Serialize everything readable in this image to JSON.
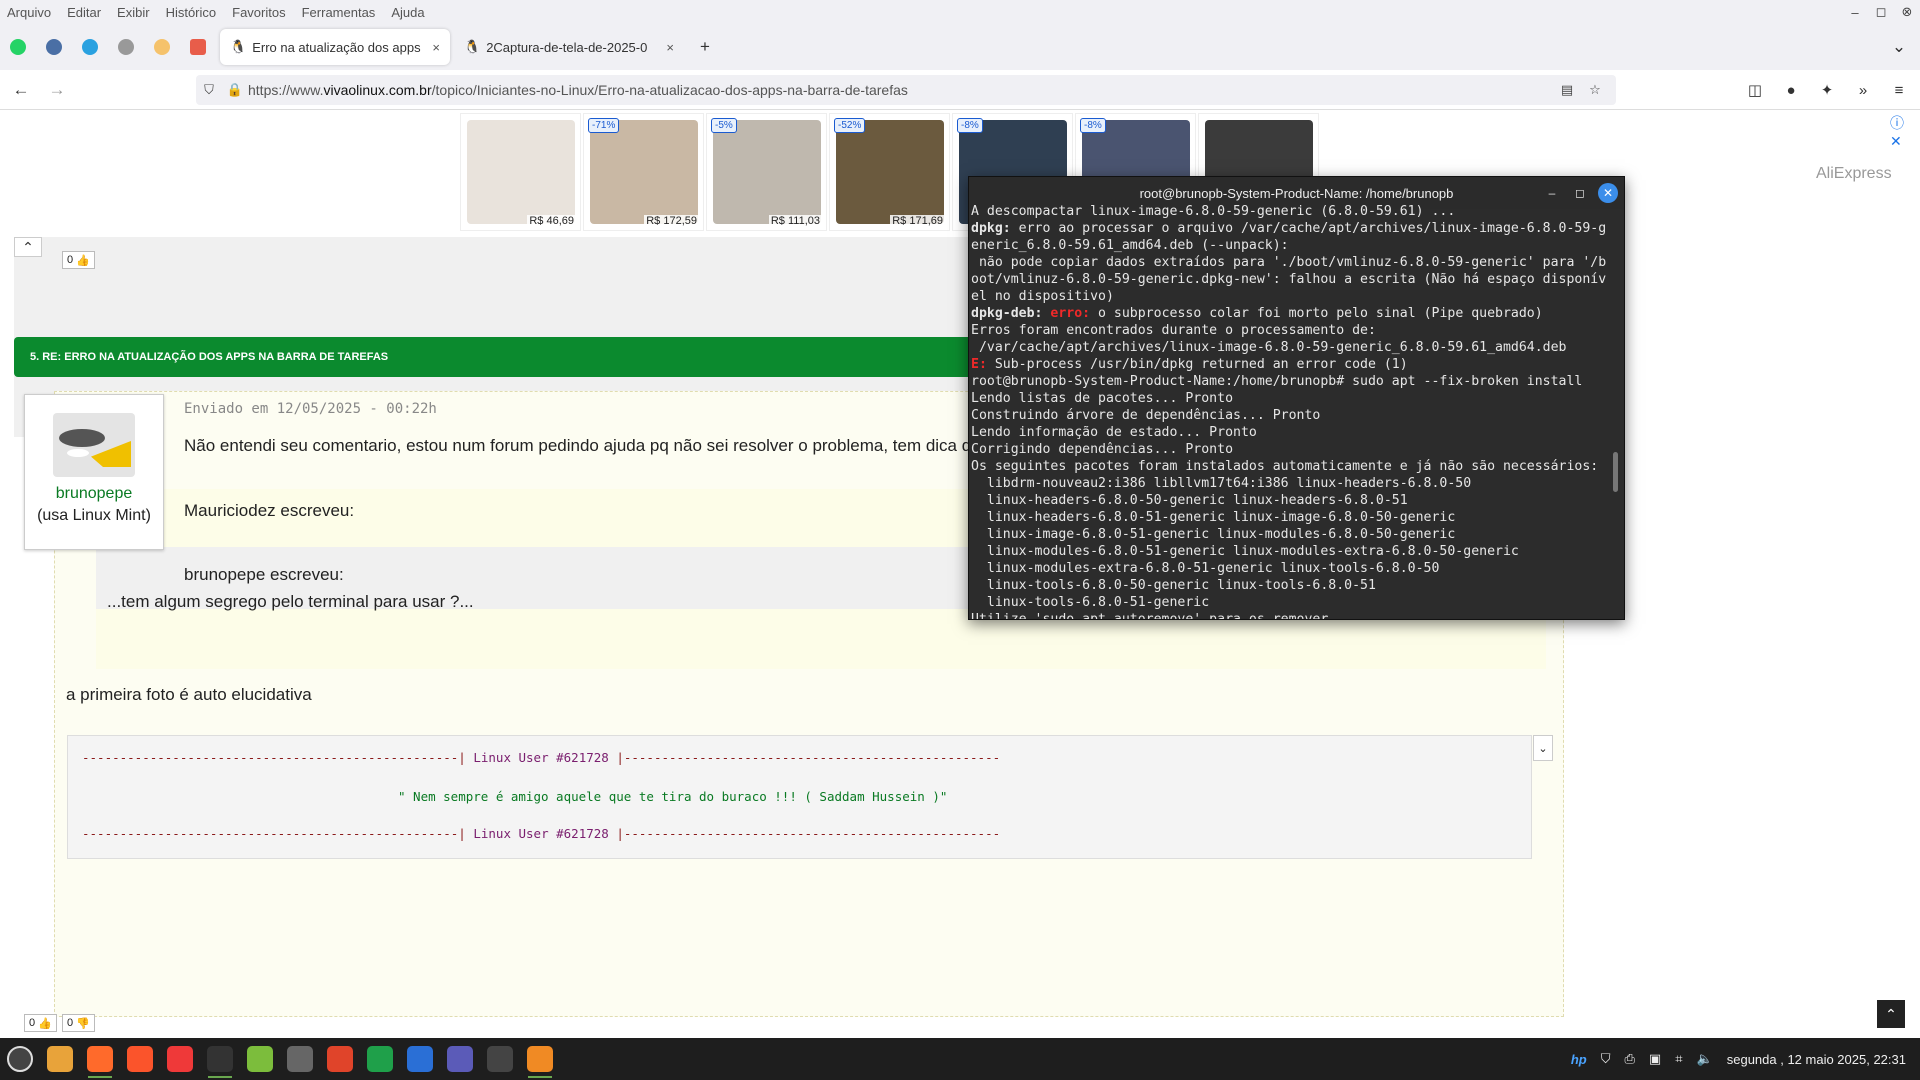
{
  "menu": [
    "Arquivo",
    "Editar",
    "Exibir",
    "Histórico",
    "Favoritos",
    "Ferramentas",
    "Ajuda"
  ],
  "tabs": [
    {
      "title": "Erro na atualização dos apps",
      "close": "×"
    },
    {
      "title": "2Captura-de-tela-de-2025-0",
      "close": "×"
    }
  ],
  "new_tab": "+",
  "url": {
    "prefix": "https://www.",
    "host": "vivaolinux.com.br",
    "path": "/topico/Iniciantes-no-Linux/Erro-na-atualizacao-dos-apps-na-barra-de-tarefas"
  },
  "ads": [
    {
      "discount": "",
      "price": "R$ 46,69",
      "color": "#e9e3dc"
    },
    {
      "discount": "-71%",
      "price": "R$ 172,59",
      "color": "#c9b8a4"
    },
    {
      "discount": "-5%",
      "price": "R$ 111,03",
      "color": "#bfb8ae"
    },
    {
      "discount": "-52%",
      "price": "R$ 171,69",
      "color": "#6b5a3e"
    },
    {
      "discount": "-8%",
      "price": "",
      "color": "#2f3f52"
    },
    {
      "discount": "-8%",
      "price": "",
      "color": "#4a5470"
    },
    {
      "discount": "",
      "price": "",
      "color": "#3b3b3b"
    }
  ],
  "ad_brand": "AliExpress",
  "votes": {
    "top": "0",
    "bottom_a": "0",
    "bottom_b": "0"
  },
  "post_header": "5. RE: ERRO NA ATUALIZAÇÃO DOS APPS NA BARRA DE TAREFAS",
  "user": {
    "name": "brunopepe",
    "distro": "(usa Linux Mint)"
  },
  "post": {
    "meta": "Enviado em 12/05/2025 - 00:22h",
    "text": "Não entendi seu comentario, estou num forum pedindo ajuda pq não sei resolver o problema, tem dica de",
    "quote_author": "Mauriciodez escreveu:",
    "nested_author": "brunopepe escreveu:",
    "nested_text": "...tem algum segrego pelo terminal para usar ?...",
    "reply": "a primeira foto é auto elucidativa"
  },
  "signature": {
    "dashes": "--------------------------------------------------|",
    "user": " Linux User #621728 ",
    "dashes2": "|--------------------------------------------------",
    "quote": "\" Nem sempre é amigo aquele que te tira do buraco !!! ( Saddam Hussein )\""
  },
  "terminal": {
    "title": "root@brunopb-System-Product-Name: /home/brunopb",
    "lines": [
      {
        "t": "A descompactar linux-image-6.8.0-59-generic (6.8.0-59.61) ..."
      },
      {
        "p": "dpkg:",
        "t": " erro ao processar o arquivo /var/cache/apt/archives/linux-image-6.8.0-59-g"
      },
      {
        "t": "eneric_6.8.0-59.61_amd64.deb (--unpack):"
      },
      {
        "t": " não pode copiar dados extraídos para './boot/vmlinuz-6.8.0-59-generic' para '/b"
      },
      {
        "t": "oot/vmlinuz-6.8.0-59-generic.dpkg-new': falhou a escrita (Não há espaço disponív"
      },
      {
        "t": "el no dispositivo)"
      },
      {
        "p": "dpkg-deb:",
        "e": " erro:",
        "t": " o subprocesso colar foi morto pelo sinal (Pipe quebrado)"
      },
      {
        "t": "Erros foram encontrados durante o processamento de:"
      },
      {
        "t": " /var/cache/apt/archives/linux-image-6.8.0-59-generic_6.8.0-59.61_amd64.deb"
      },
      {
        "e": "E:",
        "t": " Sub-process /usr/bin/dpkg returned an error code (1)"
      },
      {
        "t": "root@brunopb-System-Product-Name:/home/brunopb# sudo apt --fix-broken install"
      },
      {
        "t": "Lendo listas de pacotes... Pronto"
      },
      {
        "t": "Construindo árvore de dependências... Pronto"
      },
      {
        "t": "Lendo informação de estado... Pronto"
      },
      {
        "t": "Corrigindo dependências... Pronto"
      },
      {
        "t": "Os seguintes pacotes foram instalados automaticamente e já não são necessários:"
      },
      {
        "t": "  libdrm-nouveau2:i386 libllvm17t64:i386 linux-headers-6.8.0-50"
      },
      {
        "t": "  linux-headers-6.8.0-50-generic linux-headers-6.8.0-51"
      },
      {
        "t": "  linux-headers-6.8.0-51-generic linux-image-6.8.0-50-generic"
      },
      {
        "t": "  linux-image-6.8.0-51-generic linux-modules-6.8.0-50-generic"
      },
      {
        "t": "  linux-modules-6.8.0-51-generic linux-modules-extra-6.8.0-50-generic"
      },
      {
        "t": "  linux-modules-extra-6.8.0-51-generic linux-tools-6.8.0-50"
      },
      {
        "t": "  linux-tools-6.8.0-50-generic linux-tools-6.8.0-51"
      },
      {
        "t": "  linux-tools-6.8.0-51-generic"
      },
      {
        "t": "Utilize 'sudo apt autoremove' para os remover."
      }
    ]
  },
  "taskbar": {
    "apps": [
      {
        "name": "files-icon",
        "color": "#e8a33a",
        "open": false
      },
      {
        "name": "firefox-icon",
        "color": "#ff6a2b",
        "open": true
      },
      {
        "name": "brave-icon",
        "color": "#fb542b",
        "open": false
      },
      {
        "name": "vivaldi-icon",
        "color": "#ef3939",
        "open": false
      },
      {
        "name": "terminal-icon",
        "color": "#333333",
        "open": true
      },
      {
        "name": "chrome-icon",
        "color": "#7cbd3c",
        "open": false
      },
      {
        "name": "inkscape-icon",
        "color": "#666666",
        "open": false
      },
      {
        "name": "app-red-icon",
        "color": "#e0442a",
        "open": false
      },
      {
        "name": "calc-icon",
        "color": "#1fa04a",
        "open": false
      },
      {
        "name": "writer-icon",
        "color": "#2a6fd6",
        "open": false
      },
      {
        "name": "network-app-icon",
        "color": "#5b5bb8",
        "open": false
      },
      {
        "name": "calculator-icon",
        "color": "#444444",
        "open": false
      },
      {
        "name": "screenshot-icon",
        "color": "#f08a24",
        "open": true
      }
    ],
    "clock": "segunda , 12 maio 2025, 22:31"
  }
}
